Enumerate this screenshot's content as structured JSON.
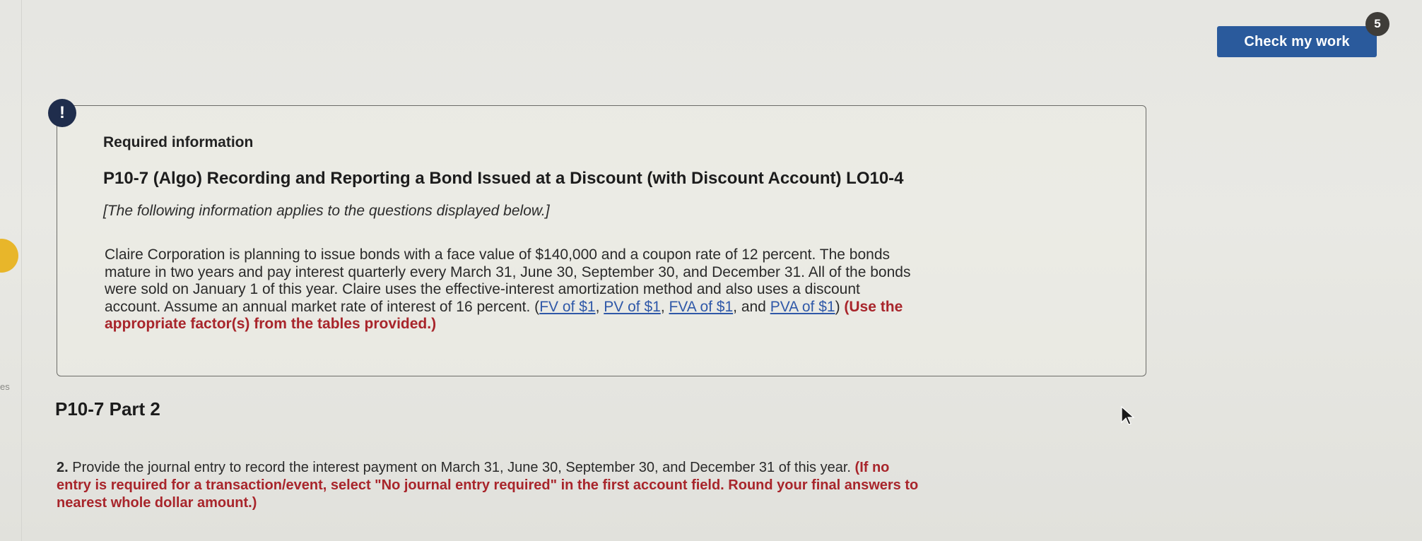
{
  "header": {
    "check_button_label": "Check my work",
    "check_badge_count": "5"
  },
  "gutter": {
    "fragment_text": "es"
  },
  "info": {
    "alert_symbol": "!",
    "required_title": "Required information",
    "problem_title": "P10-7 (Algo) Recording and Reporting a Bond Issued at a Discount (with Discount Account) LO10-4",
    "applies_note": "[The following information applies to the questions displayed below.]",
    "body_lines": [
      "Claire Corporation is planning to issue bonds with a face value of $140,000 and a coupon rate of 12 percent. The bonds",
      "mature in two years and pay interest quarterly every March 31, June 30, September 30, and December 31. All of the bonds",
      "were sold on January 1 of this year. Claire uses the effective-interest amortization method and also uses a discount",
      "account. Assume an annual market rate of interest of 16 percent. ("
    ],
    "links": {
      "fv": "FV of $1",
      "pv": "PV of $1",
      "fva": "FVA of $1",
      "pva": "PVA of $1"
    },
    "sep_comma": ", ",
    "sep_and": ", and ",
    "close_paren": ") ",
    "instruction_part1": "(Use the",
    "instruction_part2": "appropriate factor(s) from the tables provided.)"
  },
  "part": {
    "title": "P10-7 Part 2"
  },
  "question": {
    "number": "2.",
    "line1_text": " Provide the journal entry to record the interest payment on March 31, June 30, September 30, and December 31 of this year. ",
    "line1_red": "(If no",
    "line2_red": "entry is required for a transaction/event, select \"No journal entry required\" in the first account field. Round your final answers to",
    "line3_red": "nearest whole dollar amount.)"
  }
}
